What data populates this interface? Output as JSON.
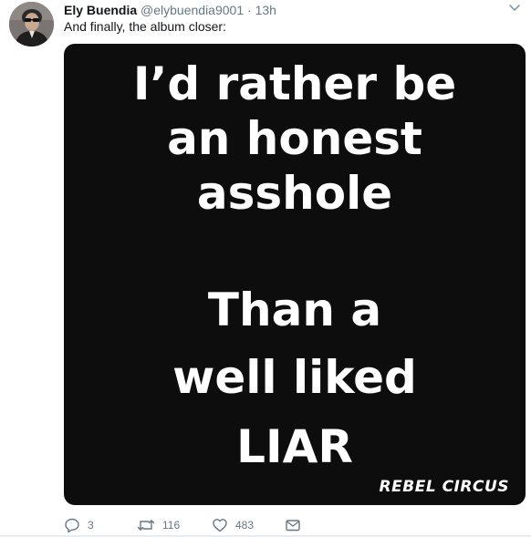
{
  "tweet": {
    "author": {
      "display_name": "Ely Buendia",
      "handle": "@elybuendia9001",
      "separator": "·",
      "time": "13h"
    },
    "text": "And finally, the album closer:",
    "media": {
      "quote_lines": [
        "I’d rather be",
        "an honest",
        "asshole",
        "Than a",
        "well liked",
        "LIAR"
      ],
      "watermark": "REBEL CIRCUS",
      "background_color": "#0d0d0d",
      "text_color": "#ffffff"
    },
    "actions": {
      "reply_icon": "reply-icon",
      "reply_count": "3",
      "retweet_icon": "retweet-icon",
      "retweet_count": "116",
      "like_icon": "heart-icon",
      "like_count": "483",
      "dm_icon": "envelope-icon"
    }
  },
  "colors": {
    "text_primary": "#14171a",
    "text_secondary": "#657786",
    "caret": "#8899a6"
  }
}
